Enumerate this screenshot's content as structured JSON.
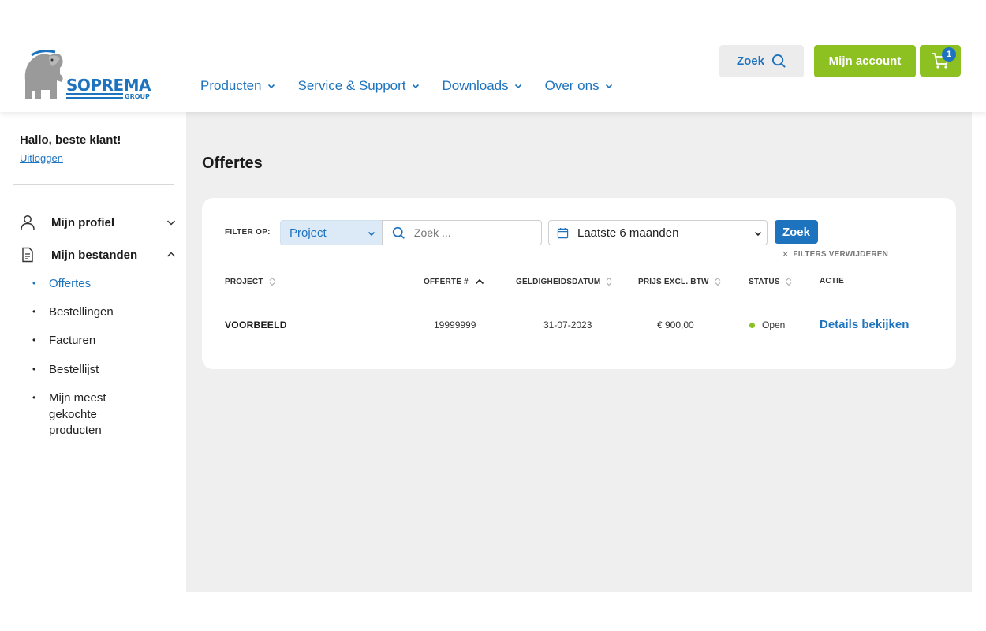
{
  "brand": {
    "name": "SOPREMA",
    "sub": "GROUP",
    "colors": {
      "primary": "#1e73be",
      "accent": "#8dc021",
      "background": "#efefef"
    }
  },
  "nav": [
    {
      "label": "Producten"
    },
    {
      "label": "Service & Support"
    },
    {
      "label": "Downloads"
    },
    {
      "label": "Over ons"
    }
  ],
  "header": {
    "search_label": "Zoek",
    "account_label": "Mijn account",
    "cart_count": "1"
  },
  "sidebar": {
    "greeting": "Hallo, beste klant!",
    "logout": "Uitloggen",
    "sections": [
      {
        "label": "Mijn profiel",
        "icon": "user-icon",
        "expanded": false
      },
      {
        "label": "Mijn bestanden",
        "icon": "document-icon",
        "expanded": true
      }
    ],
    "items": [
      {
        "label": "Offertes",
        "active": true
      },
      {
        "label": "Bestellingen",
        "active": false
      },
      {
        "label": "Facturen",
        "active": false
      },
      {
        "label": "Bestellijst",
        "active": false
      },
      {
        "label": "Mijn meest gekochte producten",
        "active": false
      }
    ]
  },
  "page": {
    "title": "Offertes",
    "filter": {
      "label": "FILTER OP:",
      "type_value": "Project",
      "search_placeholder": "Zoek ...",
      "period_value": "Laatste 6 maanden",
      "submit_label": "Zoek",
      "clear_label": "FILTERS VERWIJDEREN"
    },
    "table": {
      "columns": [
        "PROJECT",
        "OFFERTE #",
        "GELDIGHEIDSDATUM",
        "PRIJS EXCL. BTW",
        "STATUS",
        "ACTIE"
      ],
      "rows": [
        {
          "project": "VOORBEELD",
          "offerte": "19999999",
          "geldigheid": "31-07-2023",
          "prijs": "€ 900,00",
          "status": "Open",
          "actie": "Details bekijken"
        }
      ]
    }
  }
}
